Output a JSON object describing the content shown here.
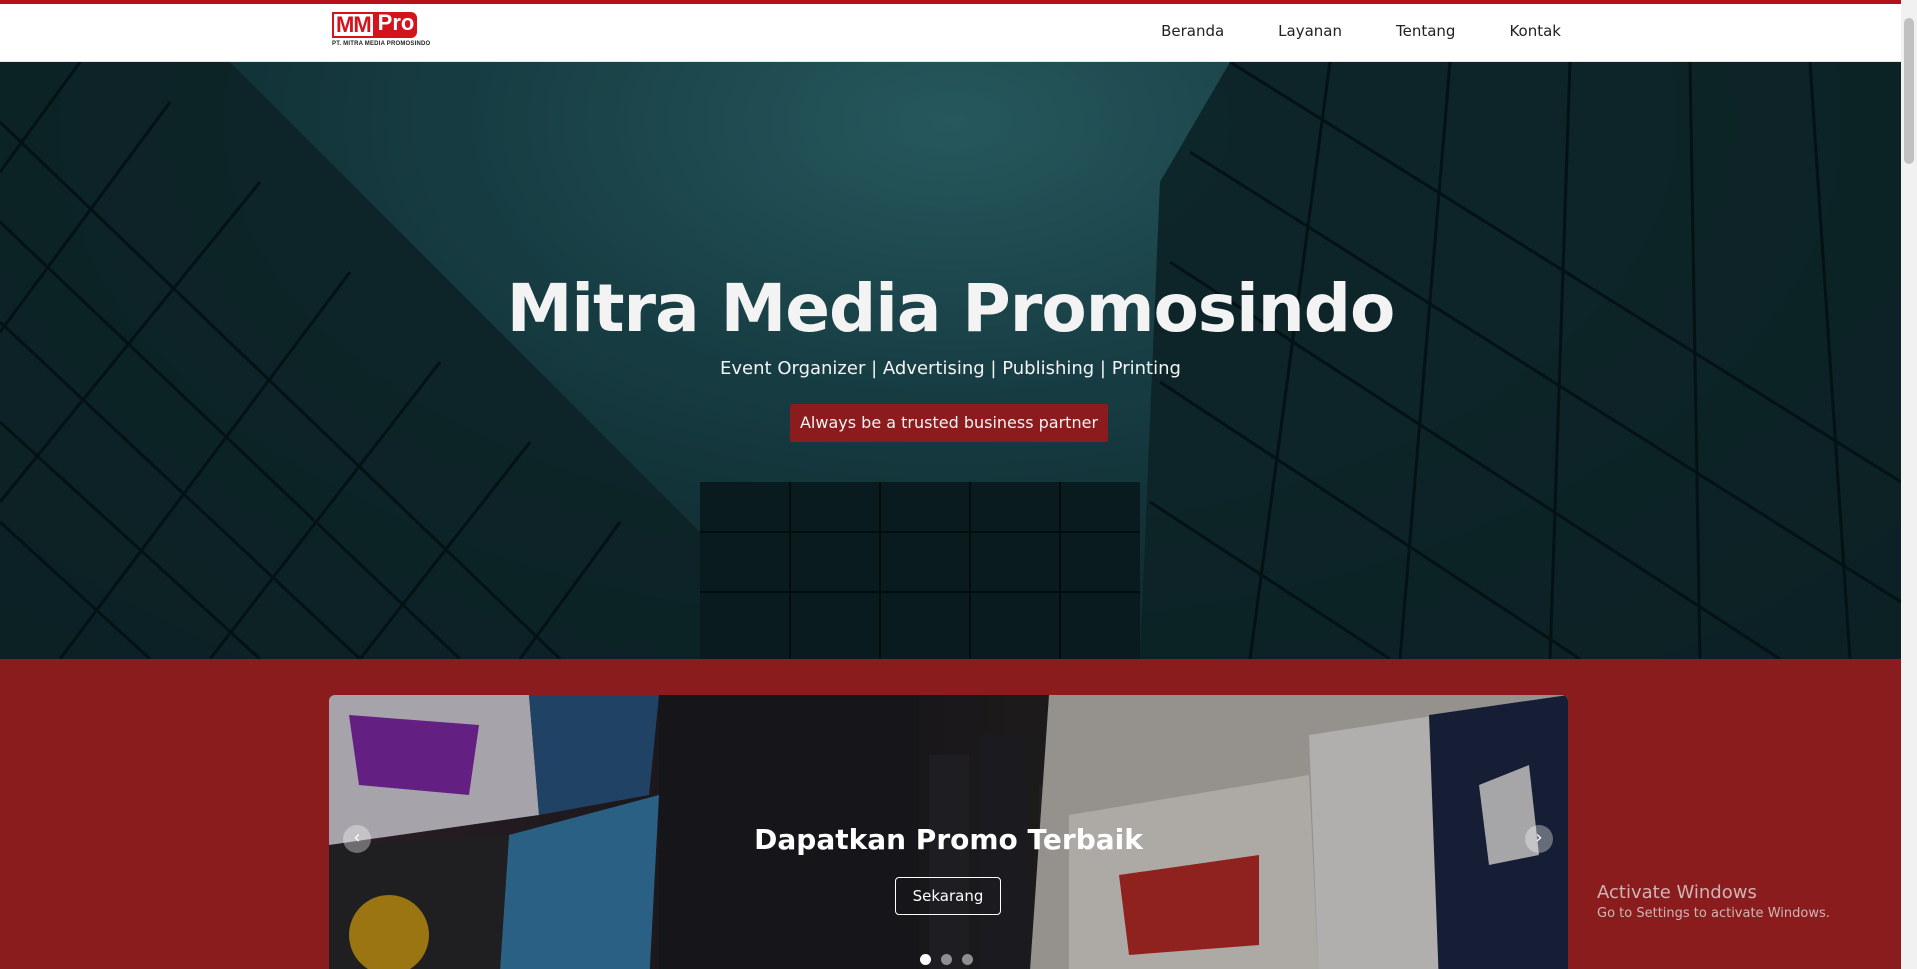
{
  "brand": {
    "logo_mm": "MM",
    "logo_pro": "Pro",
    "logo_sub": "PT. MITRA MEDIA PROMOSINDO",
    "accent": "#d3141c",
    "maroon": "#8a1c1e"
  },
  "nav": {
    "items": [
      {
        "label": "Beranda"
      },
      {
        "label": "Layanan"
      },
      {
        "label": "Tentang"
      },
      {
        "label": "Kontak"
      }
    ]
  },
  "hero": {
    "title": "Mitra Media Promosindo",
    "subtitle": "Event Organizer | Advertising | Publishing | Printing",
    "badge": "Always be a trusted business partner"
  },
  "carousel": {
    "caption": "Dapatkan Promo Terbaik",
    "button_label": "Sekarang",
    "prev_icon": "chevron-left-icon",
    "next_icon": "chevron-right-icon",
    "slides_count": 3,
    "active_slide": 1
  },
  "system": {
    "watermark_title": "Activate Windows",
    "watermark_sub": "Go to Settings to activate Windows."
  }
}
